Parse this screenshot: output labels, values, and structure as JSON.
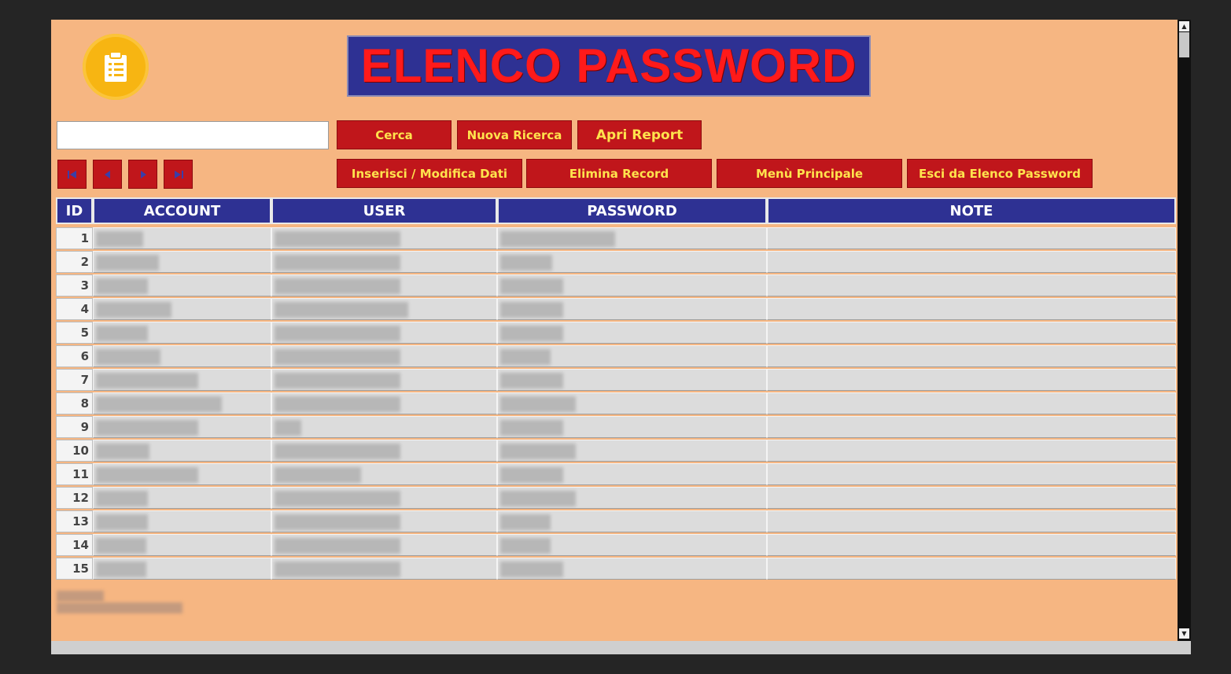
{
  "title": "ELENCO PASSWORD",
  "colors": {
    "form_bg": "#f6b682",
    "title_bg": "#2e3193",
    "title_text": "#ff1a1a",
    "button_bg": "#c0161b",
    "button_text": "#ffe34d",
    "header_bg": "#2e3193"
  },
  "logo_icon": "clipboard-checklist-icon",
  "search": {
    "value": "",
    "placeholder": ""
  },
  "buttons": {
    "cerca": "Cerca",
    "nuova_ricerca": "Nuova Ricerca",
    "apri_report": "Apri Report",
    "inserisci": "Inserisci / Modifica Dati",
    "elimina": "Elimina Record",
    "menu": "Menù Principale",
    "esci": "Esci da Elenco Password"
  },
  "nav_icons": [
    "first-record-icon",
    "previous-record-icon",
    "next-record-icon",
    "last-record-icon"
  ],
  "columns": [
    "ID",
    "ACCOUNT",
    "USER",
    "PASSWORD",
    "NOTE"
  ],
  "rows": [
    {
      "id": "1"
    },
    {
      "id": "2"
    },
    {
      "id": "3"
    },
    {
      "id": "4"
    },
    {
      "id": "5"
    },
    {
      "id": "6"
    },
    {
      "id": "7"
    },
    {
      "id": "8"
    },
    {
      "id": "9"
    },
    {
      "id": "10"
    },
    {
      "id": "11"
    },
    {
      "id": "12"
    },
    {
      "id": "13"
    },
    {
      "id": "14"
    },
    {
      "id": "15"
    }
  ]
}
